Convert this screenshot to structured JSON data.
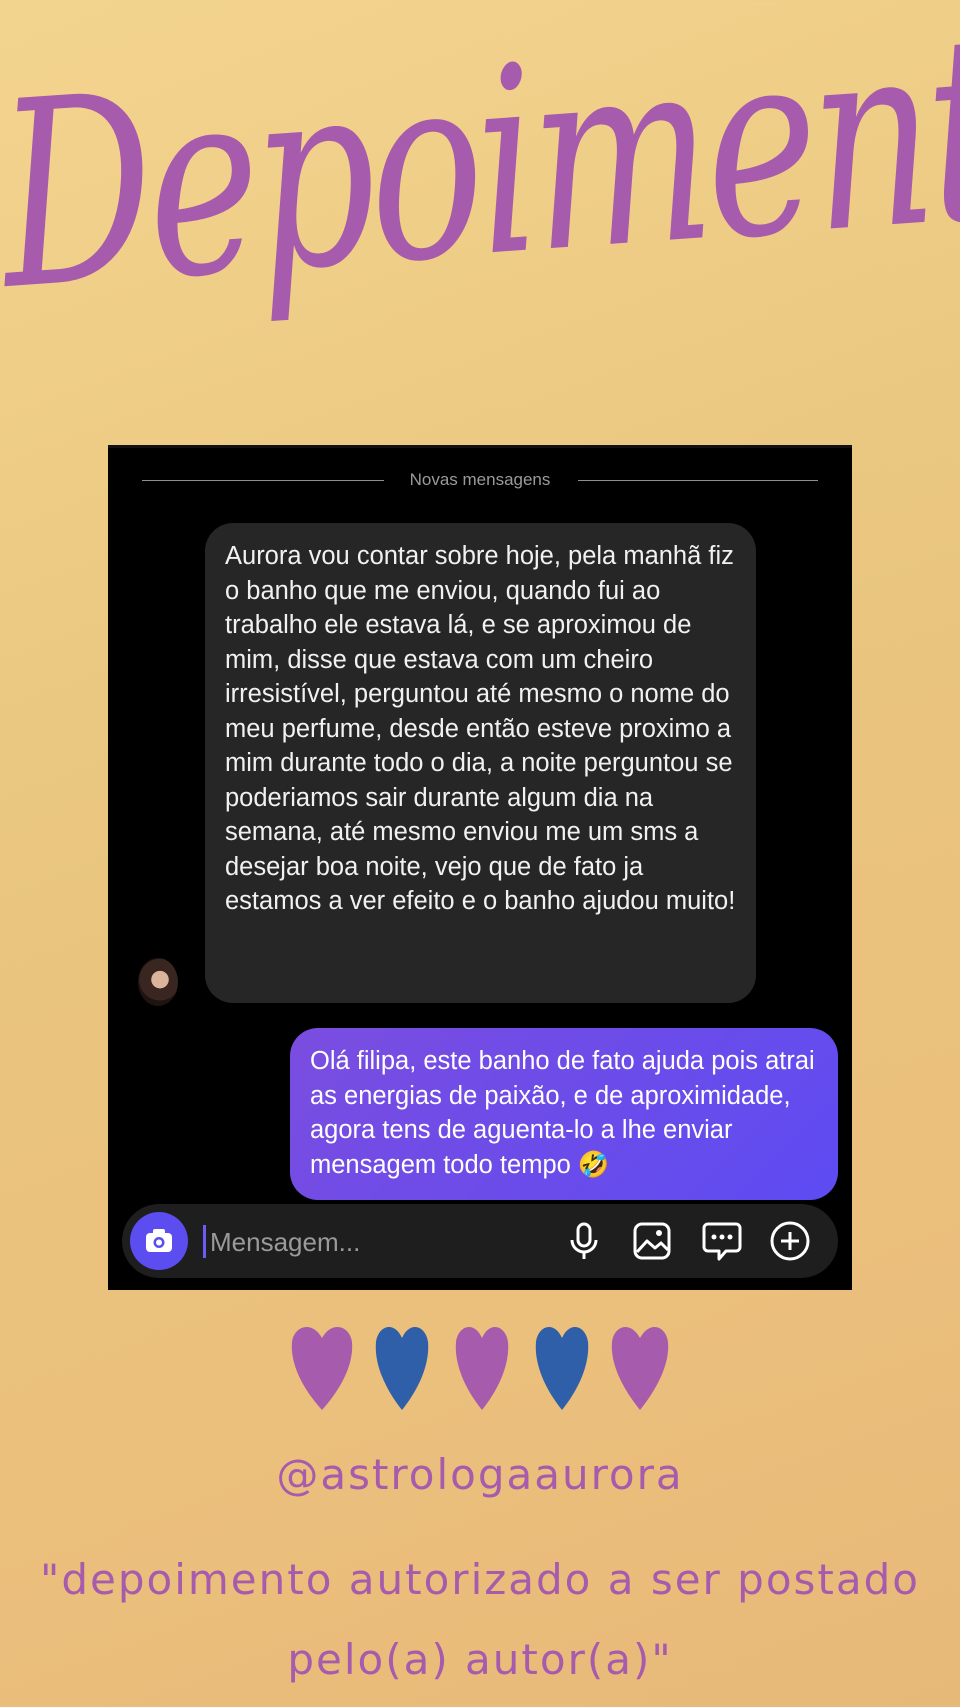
{
  "header": {
    "title": "Depoimentos"
  },
  "chat": {
    "divider_label": "Novas mensagens",
    "received_message": "Aurora vou contar sobre hoje, pela manhã fiz o banho que me enviou, quando fui ao trabalho ele estava lá, e se aproximou de mim, disse que estava com um cheiro irresistível, perguntou até mesmo o nome do meu perfume, desde então esteve proximo a mim durante todo o dia, a noite perguntou se poderiamos sair durante algum dia na semana, até mesmo enviou me um sms a desejar boa noite, vejo que de fato ja estamos a ver efeito e o banho ajudou muito!",
    "sent_message": "Olá filipa, este banho de fato ajuda pois atrai as energias de paixão, e de aproximidade, agora tens de aguenta-lo a lhe enviar mensagem todo tempo 🤣",
    "input_placeholder": "Mensagem..."
  },
  "icons": [
    "camera-icon",
    "microphone-icon",
    "gallery-icon",
    "sticker-icon",
    "plus-icon"
  ],
  "colors": {
    "accent_purple": "#a65bad",
    "accent_blue": "#2e5fa8",
    "send_bubble": "#6a4ff0"
  },
  "footer": {
    "handle": "@astrologaaurora",
    "note": "\"depoimento autorizado a ser postado pelo(a) autor(a)\""
  }
}
